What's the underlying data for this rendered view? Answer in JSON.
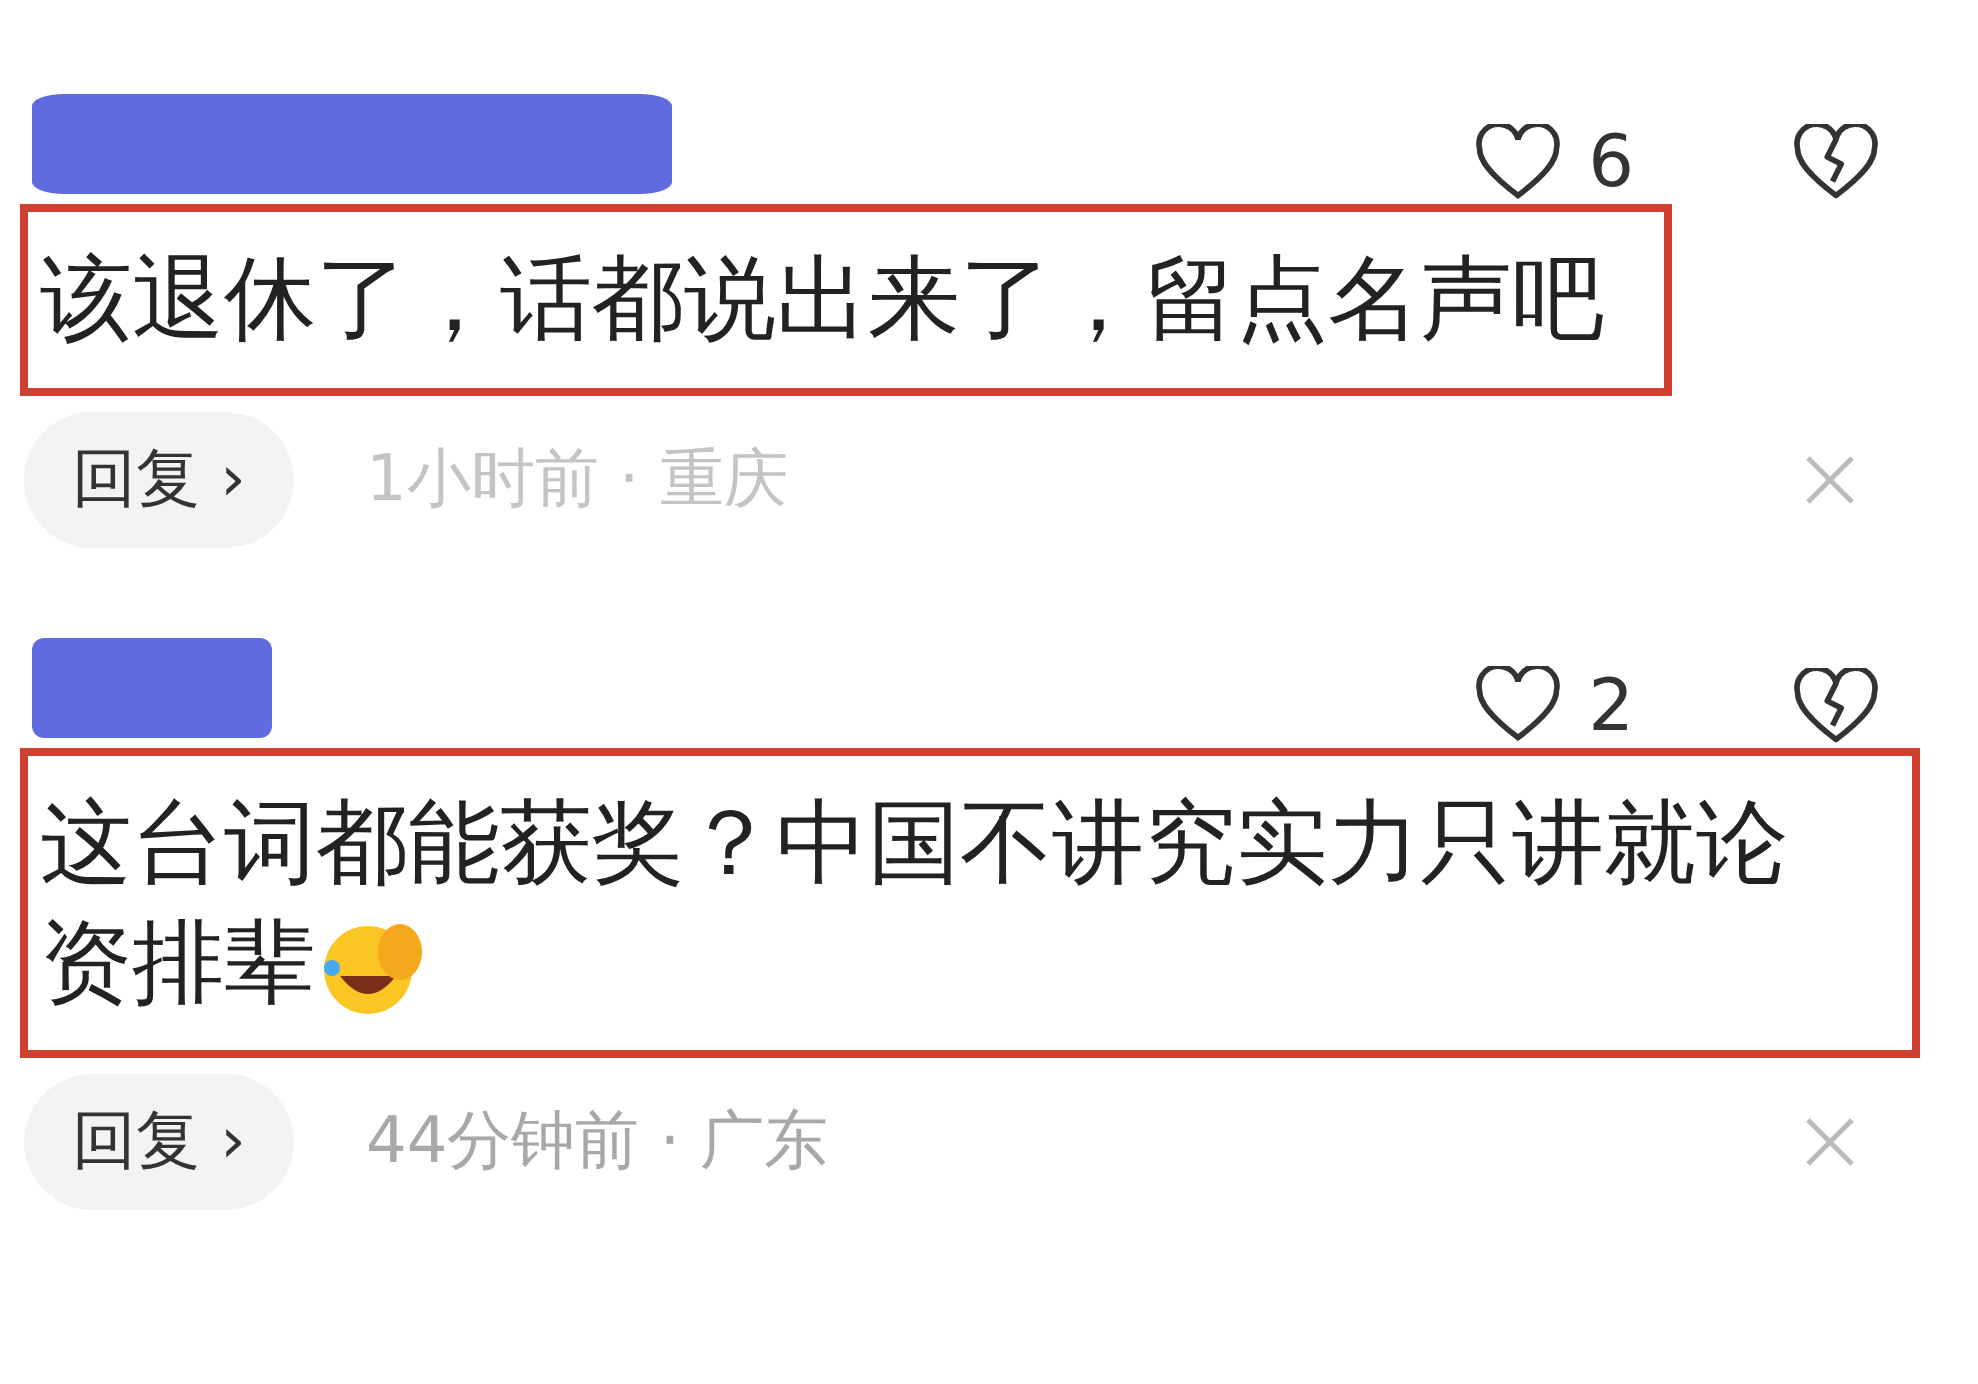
{
  "comments": [
    {
      "likes": "6",
      "text": "该退休了，话都说出来了，留点名声吧",
      "highlighted": true,
      "reply": "回复 ›",
      "time": "1小时前 · 重庆"
    },
    {
      "likes": "2",
      "text": "这台词都能获奖？中国不讲究实力只讲就论资排辈",
      "emoji": true,
      "highlighted": true,
      "reply": "回复 ›",
      "time": "44分钟前 · 广东"
    }
  ]
}
